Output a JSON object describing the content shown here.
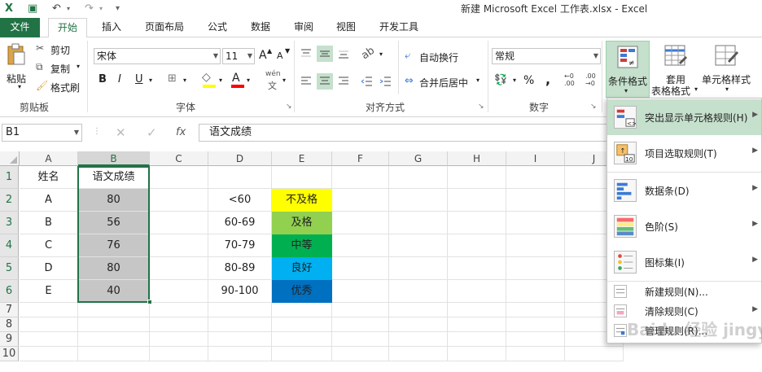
{
  "window": {
    "title": "新建 Microsoft Excel 工作表.xlsx - Excel"
  },
  "tabs": [
    "文件",
    "开始",
    "插入",
    "页面布局",
    "公式",
    "数据",
    "审阅",
    "视图",
    "开发工具"
  ],
  "ribbon": {
    "clipboard": {
      "paste": "粘贴",
      "cut": "剪切",
      "copy": "复制",
      "format_painter": "格式刷",
      "group": "剪贴板"
    },
    "font": {
      "name": "宋体",
      "size": "11",
      "bold": "B",
      "italic": "I",
      "underline": "U",
      "color_a": "A",
      "wen": "wén",
      "grow": "A",
      "shrink": "A",
      "group": "字体"
    },
    "alignment": {
      "wrap": "自动换行",
      "merge": "合并后居中",
      "group": "对齐方式"
    },
    "number": {
      "format": "常规",
      "percent": "%",
      "comma": ",",
      "group": "数字"
    },
    "styles": {
      "conditional": "条件格式",
      "table_line1": "套用",
      "table_line2": "表格格式",
      "cell_styles": "单元格样式"
    }
  },
  "formula_bar": {
    "name_box": "B1",
    "fx": "fx",
    "content": "语文成绩"
  },
  "columns": [
    "A",
    "B",
    "C",
    "D",
    "E",
    "F",
    "G",
    "H",
    "I",
    "J"
  ],
  "rows": [
    "1",
    "2",
    "3",
    "4",
    "5",
    "6",
    "7",
    "8",
    "9",
    "10"
  ],
  "cells": {
    "A": [
      "姓名",
      "A",
      "B",
      "C",
      "D",
      "E"
    ],
    "B": [
      "语文成绩",
      "80",
      "56",
      "76",
      "80",
      "40"
    ],
    "D": [
      "",
      "<60",
      "60-69",
      "70-79",
      "80-89",
      "90-100"
    ],
    "E": [
      "",
      "不及格",
      "及格",
      "中等",
      "良好",
      "优秀"
    ]
  },
  "colors": {
    "excel_green": "#217346",
    "selection_fill": "#c6c6c6",
    "e_fills": [
      "#ffff00",
      "#92d050",
      "#00b050",
      "#00b0f0",
      "#0070c0"
    ]
  },
  "menu": {
    "items": [
      {
        "label": "突出显示单元格规则(H)",
        "icon": "highlight-rules-icon"
      },
      {
        "label": "项目选取规则(T)",
        "icon": "top-bottom-rules-icon"
      },
      {
        "label": "数据条(D)",
        "icon": "data-bars-icon"
      },
      {
        "label": "色阶(S)",
        "icon": "color-scales-icon"
      },
      {
        "label": "图标集(I)",
        "icon": "icon-sets-icon"
      }
    ],
    "small_items": [
      "新建规则(N)...",
      "清除规则(C)",
      "管理规则(R)..."
    ]
  },
  "watermark": "Baidu 经验 jingyan.baidu.com"
}
